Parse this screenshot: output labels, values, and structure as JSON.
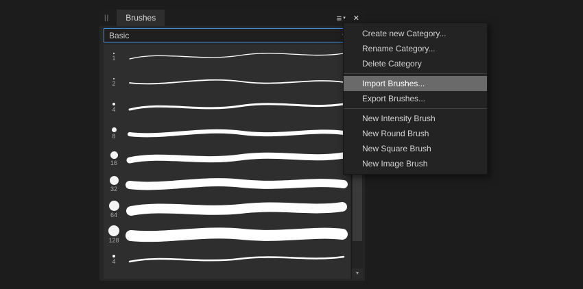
{
  "panel": {
    "tab_label": "Brushes",
    "grip_icon": "||",
    "menu_icon": "≡",
    "menu_caret_icon": "▾",
    "close_icon": "✕",
    "category": "Basic",
    "select_caret_icon": "▾",
    "scroll_down_icon": "▼"
  },
  "brushes": [
    {
      "size": "1"
    },
    {
      "size": "2"
    },
    {
      "size": "4"
    },
    {
      "size": "8"
    },
    {
      "size": "16"
    },
    {
      "size": "32"
    },
    {
      "size": "64"
    },
    {
      "size": "128"
    },
    {
      "size": "4"
    }
  ],
  "menu": {
    "items": [
      {
        "label": "Create new Category...",
        "highlighted": false
      },
      {
        "label": "Rename Category...",
        "highlighted": false
      },
      {
        "label": "Delete Category",
        "highlighted": false
      },
      {
        "label": "Import Brushes...",
        "highlighted": true
      },
      {
        "label": "Export Brushes...",
        "highlighted": false
      },
      {
        "label": "New Intensity Brush",
        "highlighted": false
      },
      {
        "label": "New Round Brush",
        "highlighted": false
      },
      {
        "label": "New Square Brush",
        "highlighted": false
      },
      {
        "label": "New Image Brush",
        "highlighted": false
      }
    ]
  },
  "colors": {
    "background": "#1c1c1c",
    "panel_background": "#262626",
    "list_background": "#2e2e2e",
    "focus_accent": "#4a8ed2",
    "menu_highlight": "#6a6a6a",
    "stroke_color": "#ffffff"
  }
}
